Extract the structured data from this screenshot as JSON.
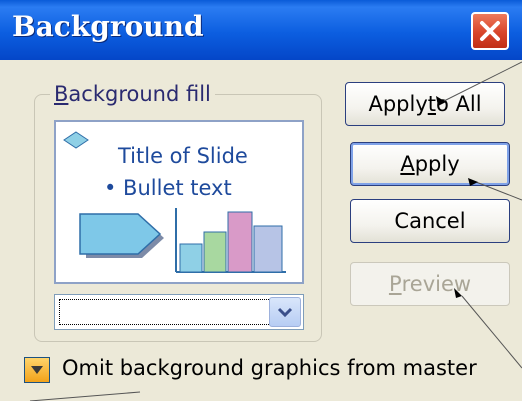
{
  "window": {
    "title": "Background",
    "close_icon": "close-x-icon"
  },
  "fill_group": {
    "label_hotkey": "B",
    "label_rest": "ackground fill",
    "preview": {
      "slide_title": "Title of Slide",
      "bullet": "• Bullet text",
      "icons": [
        "diamond-bullet-icon",
        "pentagon-arrow-shape",
        "bar-graphic"
      ]
    },
    "color_dropdown": {
      "value": "",
      "arrow_icon": "chevron-down-icon"
    }
  },
  "buttons": {
    "apply_all": {
      "before": "Apply ",
      "hotkey": "t",
      "after": "o All"
    },
    "apply": {
      "before": "",
      "hotkey": "A",
      "after": "pply"
    },
    "cancel": {
      "label": "Cancel"
    },
    "preview": {
      "before": "",
      "hotkey": "P",
      "after": "review"
    }
  },
  "omit_option": {
    "checked": true,
    "label_before": "Omit background ",
    "hotkey": "g",
    "label_after": "raphics from master"
  },
  "colors": {
    "titlebar": "#0c5ee0",
    "dialog_bg": "#ece9d8",
    "close_button": "#d8452a",
    "preview_text": "#1e4a9c",
    "bar_colors": [
      "#8fd0e6",
      "#a8d8a0",
      "#d99ac8",
      "#b7c4e6"
    ]
  }
}
